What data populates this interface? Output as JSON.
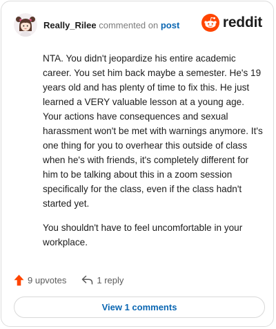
{
  "header": {
    "username": "Really_Rilee",
    "action_text": "commented on",
    "target_link": "post",
    "brand": "reddit"
  },
  "comment": {
    "paragraphs": [
      "NTA. You didn't jeopardize his entire academic career. You set him back maybe a semester. He's 19 years old and has plenty of time to fix this. He just learned a VERY valuable lesson at a young age. Your actions have consequences and sexual harassment won't be met with warnings anymore. It's one thing for you to overhear this outside of class when he's with friends, it's completely different for him to be talking about this in a zoom session specifically for the class, even if the class hadn't started yet.",
      "You shouldn't have to feel uncomfortable in your workplace."
    ]
  },
  "footer": {
    "upvotes_label": "9 upvotes",
    "replies_label": "1 reply",
    "view_comments_label": "View 1 comments"
  },
  "colors": {
    "upvote_accent": "#ff4500",
    "reddit_orange": "#ff4500",
    "link_blue": "#0a66b2"
  },
  "icons": {
    "avatar": "avatar-girl-pigtails",
    "brand_logo": "reddit-snoo-icon",
    "upvote": "upvote-arrow-icon",
    "reply": "reply-arrow-icon"
  }
}
